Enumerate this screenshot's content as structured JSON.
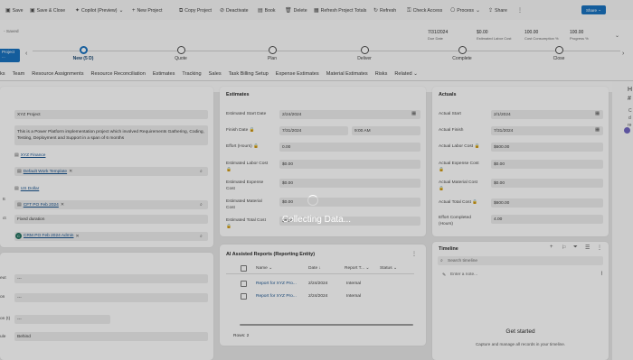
{
  "command_bar": {
    "save": "Save",
    "save_close": "Save & Close",
    "copilot": "Copilot (Preview)",
    "new_project": "New Project",
    "copy_project": "Copy Project",
    "deactivate": "Deactivate",
    "book": "Book",
    "delete": "Delete",
    "refresh_totals": "Refresh Project Totals",
    "refresh": "Refresh",
    "check_access": "Check Access",
    "process": "Process",
    "share": "Share",
    "share_button": "Share"
  },
  "header": {
    "saved": "- Saved",
    "date": "7/31/2024",
    "date_label": "Due Date",
    "cost": "$0.00",
    "cost_label": "Estimated Labor Cost",
    "cost_consumption": "100.00",
    "cost_consumption_label": "Cost Consumption %",
    "progress": "100.00",
    "progress_label": "Progress %"
  },
  "bpf": {
    "active_label": "Project ...",
    "stages": [
      {
        "name": "New  (5 D)"
      },
      {
        "name": "Quote"
      },
      {
        "name": "Plan"
      },
      {
        "name": "Deliver"
      },
      {
        "name": "Complete"
      },
      {
        "name": "Close"
      }
    ]
  },
  "tabs": [
    "ks",
    "Team",
    "Resource Assignments",
    "Resource Reconciliation",
    "Estimates",
    "Tracking",
    "Sales",
    "Task Billing Setup",
    "Expense Estimates",
    "Material Estimates",
    "Risks",
    "Related"
  ],
  "general": {
    "project_name": "XYZ Project",
    "description": "This is a Power Platform implementation project which involved Requirements Gathering, Coding, Testing, Deployment and Support in a span of 6 months",
    "customer": "XYZ Finance",
    "work_template": "Default Work Template",
    "currency": "US Dollar",
    "price_list": "CFT PO Feb 2024",
    "contract_type": "Fixed duration",
    "manager": "CRM PO Feb 2024 Admin",
    "manager_initials": "C",
    "side_labels": [
      "tt",
      "ct"
    ]
  },
  "lower_left": {
    "field1": "---",
    "field2": "---",
    "field3": "---",
    "status": "Behind",
    "side_labels": [
      "eut",
      "on",
      "on (t)",
      "ule"
    ]
  },
  "estimates": {
    "title": "Estimates",
    "start_label": "Estimated Start Date",
    "start": "2/24/2024",
    "finish_label": "Finish Date",
    "finish_date": "7/31/2024",
    "finish_time": "9:00 AM",
    "effort_label": "Effort (Hours)",
    "effort": "0.00",
    "labor_label": "Estimated Labor Cost",
    "labor": "$0.00",
    "expense_label": "Estimated Expense Cost",
    "expense": "$0.00",
    "material_label": "Estimated Material Cost",
    "material": "$0.00",
    "total_label": "Estimated Total Cost",
    "total": "$0.00"
  },
  "actuals": {
    "title": "Actuals",
    "start_label": "Actual Start",
    "start": "2/1/2024",
    "finish_label": "Actual Finish",
    "finish": "7/31/2024",
    "labor_label": "Actual Labor Cost",
    "labor": "$600.00",
    "expense_label": "Actual Expense Cost",
    "expense": "$0.00",
    "material_label": "Actual Material Cost",
    "material": "$0.00",
    "total_label": "Actual Total Cost",
    "total": "$600.00",
    "effort_label": "Effort Completed (Hours)",
    "effort": "4.00"
  },
  "reports": {
    "title": "AI Assisted Reports (Reporting Entity)",
    "columns": [
      "Name",
      "Date",
      "Report T...",
      "Status"
    ],
    "rows": [
      {
        "name": "Report for XYZ Pro...",
        "date": "2/24/2024",
        "type": "Internal",
        "status": ""
      },
      {
        "name": "Report for XYZ Pro...",
        "date": "2/24/2024",
        "type": "Internal",
        "status": ""
      }
    ],
    "rows_label": "Rows: 2"
  },
  "timeline": {
    "title": "Timeline",
    "search_placeholder": "Search timeline",
    "note_placeholder": "Enter a note...",
    "empty_title": "Get started",
    "empty_text": "Capture and manage all records in your timeline."
  },
  "right_peek": [
    "H",
    "#",
    "C",
    "d",
    "re"
  ],
  "overlay": {
    "text": "Collecting Data..."
  }
}
